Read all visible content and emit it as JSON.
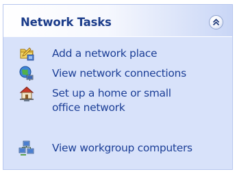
{
  "panel": {
    "title": "Network Tasks",
    "collapse_icon": "double-chevron-up-icon",
    "tasks": [
      {
        "label": "Add a network place",
        "icon": "add-network-place-icon"
      },
      {
        "label": "View network connections",
        "icon": "network-connections-icon"
      },
      {
        "label_lines": [
          "Set up a home or small",
          "office network"
        ],
        "icon": "home-network-icon"
      },
      {
        "label": "View workgroup computers",
        "icon": "workgroup-computers-icon"
      }
    ]
  },
  "colors": {
    "title": "#1b3c8a",
    "link": "#1c3f97",
    "panel_bg": "#d8e2fa"
  }
}
